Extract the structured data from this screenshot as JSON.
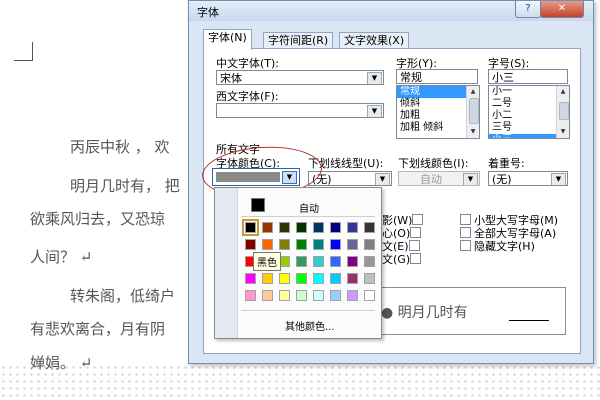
{
  "document": {
    "lines": [
      "丙辰中秋 ， 欢",
      "明月几时有， 把",
      "欲乘风归去，又恐琼",
      "人间？ ↵",
      "转朱阁，低绮户",
      "有悲欢离合，月有阴",
      "婵娟。 ↵"
    ]
  },
  "dialog": {
    "title": "字体",
    "help_button": "?",
    "close_button": "✕",
    "tabs": [
      "字体(N)",
      "字符间距(R)",
      "文字效果(X)"
    ],
    "chinese_font": {
      "label": "中文字体(T):",
      "value": "宋体"
    },
    "western_font": {
      "label": "西文字体(F):",
      "value": ""
    },
    "style": {
      "label": "字形(Y):",
      "value": "常规",
      "options": [
        "常规",
        "倾斜",
        "加粗",
        "加粗 倾斜"
      ],
      "selected": "常规"
    },
    "size": {
      "label": "字号(S):",
      "value": "小三",
      "options": [
        "小一",
        "二号",
        "小二",
        "三号",
        "小三"
      ],
      "selected": "小三"
    },
    "all_text": {
      "heading": "所有文字",
      "font_color_label": "字体颜色(C):",
      "underline_type_label": "下划线线型(U):",
      "underline_type_value": "(无)",
      "underline_color_label": "下划线颜色(I):",
      "underline_color_value": "自动",
      "emphasis_label": "着重号:",
      "emphasis_value": "(无)"
    },
    "effects_partial": [
      "影(W)",
      "心(O)",
      "文(E)",
      "文(G)"
    ],
    "effects": [
      "小型大写字母(M)",
      "全部大写字母(A)",
      "隐藏文字(H)"
    ],
    "preview_text": "明月几时有"
  },
  "color_popup": {
    "auto_label": "自动",
    "auto_color": "#000000",
    "tooltip": "黑色",
    "more_colors": "其他颜色...",
    "selected_color": "#000000",
    "rows": [
      [
        "#000000",
        "#993300",
        "#333300",
        "#003300",
        "#003366",
        "#000080",
        "#333399",
        "#333333"
      ],
      [
        "#800000",
        "#ff6600",
        "#808000",
        "#008000",
        "#008080",
        "#0000ff",
        "#666699",
        "#808080"
      ],
      [
        "#ff0000",
        "#ff9900",
        "#99cc00",
        "#339966",
        "#33cccc",
        "#3366ff",
        "#800080",
        "#969696"
      ],
      [
        "#ff00ff",
        "#ffcc00",
        "#ffff00",
        "#00ff00",
        "#00ffff",
        "#00ccff",
        "#993366",
        "#c0c0c0"
      ],
      [
        "#ff99cc",
        "#ffcc99",
        "#ffff99",
        "#ccffcc",
        "#ccffff",
        "#99ccff",
        "#cc99ff",
        "#ffffff"
      ]
    ]
  }
}
